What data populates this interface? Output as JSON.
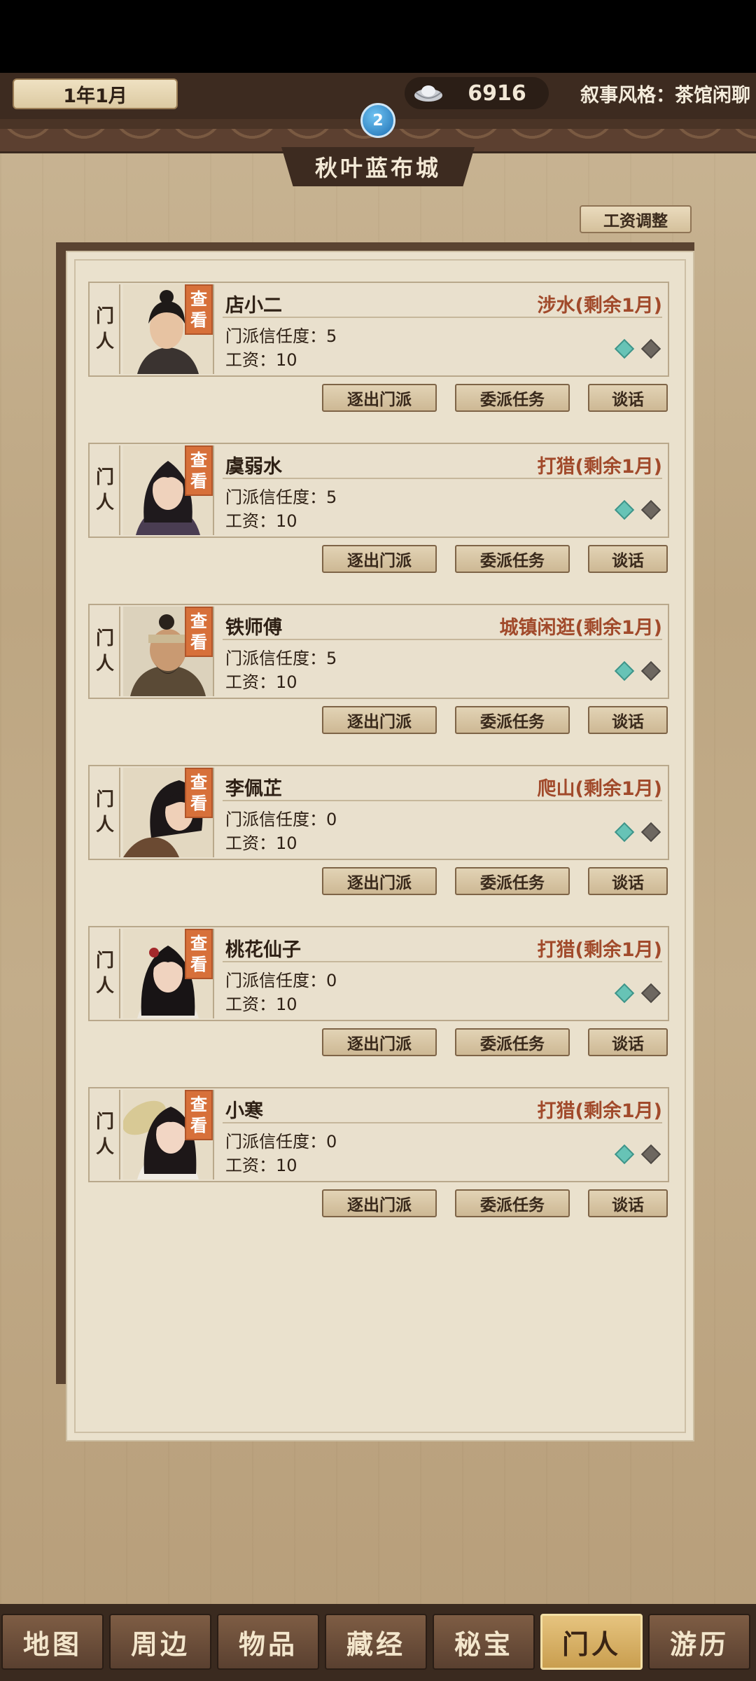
{
  "header": {
    "date": "1年1月",
    "silver": "6916",
    "narrative_style": "叙事风格：茶馆闲聊",
    "notification_count": "2",
    "city": "秋叶蓝布城",
    "wage_adjust_label": "工资调整"
  },
  "labels": {
    "tag_line1": "门",
    "tag_line2": "人",
    "view_line1": "查",
    "view_line2": "看",
    "expel": "逐出门派",
    "assign": "委派任务",
    "talk": "谈话"
  },
  "members": [
    {
      "name": "店小二",
      "status": "涉水(剩余1月)",
      "trust": "门派信任度：5",
      "wage": "工资：10"
    },
    {
      "name": "虞弱水",
      "status": "打猎(剩余1月)",
      "trust": "门派信任度：5",
      "wage": "工资：10"
    },
    {
      "name": "铁师傅",
      "status": "城镇闲逛(剩余1月)",
      "trust": "门派信任度：5",
      "wage": "工资：10"
    },
    {
      "name": "李佩芷",
      "status": "爬山(剩余1月)",
      "trust": "门派信任度：0",
      "wage": "工资：10"
    },
    {
      "name": "桃花仙子",
      "status": "打猎(剩余1月)",
      "trust": "门派信任度：0",
      "wage": "工资：10"
    },
    {
      "name": "小寒",
      "status": "打猎(剩余1月)",
      "trust": "门派信任度：0",
      "wage": "工资：10"
    }
  ],
  "nav": [
    "地图",
    "周边",
    "物品",
    "藏经",
    "秘宝",
    "门人",
    "游历"
  ],
  "nav_active": "门人",
  "colors": {
    "accent": "#d7703a",
    "status_text": "#a14a2b",
    "nav_active": "#e6c47f"
  }
}
